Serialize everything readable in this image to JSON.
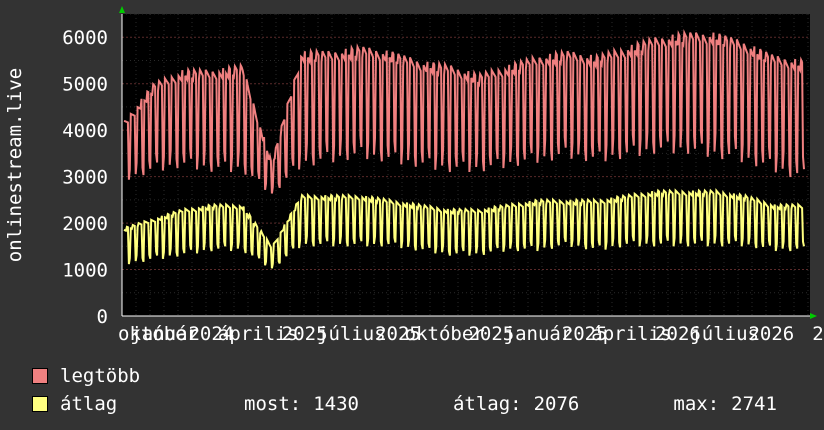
{
  "chart_data": {
    "type": "line",
    "ylabel": "onlinestream.live",
    "ylim": [
      0,
      6500
    ],
    "y_ticks": [
      "0",
      "1000",
      "2000",
      "3000",
      "4000",
      "5000",
      "6000"
    ],
    "x_tick_labels": [
      "október",
      "január",
      "2024",
      "április",
      "2025",
      "július",
      "2025",
      "október",
      "2025",
      "január",
      "2025",
      "április",
      "2026",
      "július",
      "2026",
      "2"
    ],
    "grid": true,
    "colors": {
      "background": "#000000",
      "grid_major": "#5a2a2a",
      "grid_minor": "#2a2a2a",
      "axis": "#ffffff",
      "arrow": "#00cc00"
    },
    "series": [
      {
        "name": "legtöbb",
        "color": "#f08080",
        "envelope_values": [
          4200,
          5000,
          5300,
          5300,
          5400,
          3300,
          5700,
          5700,
          5800,
          5700,
          5500,
          5400,
          5200,
          5400,
          5600,
          5700,
          5600,
          5800,
          6000,
          6100,
          6100,
          5900,
          5600,
          5500
        ],
        "dip_values": [
          2900,
          3100,
          3200,
          3100,
          3100,
          2600,
          3200,
          3300,
          3400,
          3300,
          3200,
          3100,
          3100,
          3200,
          3300,
          3400,
          3300,
          3400,
          3500,
          3500,
          3400,
          3300,
          3100,
          2900
        ]
      },
      {
        "name": "átlag",
        "color": "#ffff80",
        "envelope_values": [
          1900,
          2100,
          2300,
          2400,
          2400,
          1500,
          2600,
          2600,
          2600,
          2500,
          2400,
          2300,
          2300,
          2400,
          2500,
          2500,
          2500,
          2600,
          2700,
          2700,
          2700,
          2600,
          2400,
          2400
        ],
        "dip_values": [
          1100,
          1200,
          1300,
          1400,
          1400,
          1000,
          1500,
          1500,
          1500,
          1500,
          1400,
          1300,
          1300,
          1400,
          1400,
          1500,
          1400,
          1500,
          1500,
          1500,
          1500,
          1500,
          1400,
          1400
        ]
      }
    ]
  },
  "legend": {
    "items": [
      {
        "label": "legtöbb",
        "color": "#f08080"
      },
      {
        "label": "átlag",
        "color": "#ffff80"
      }
    ],
    "stats": [
      {
        "label": "most:",
        "value": "1430"
      },
      {
        "label": "átlag:",
        "value": "2076"
      },
      {
        "label": "max:",
        "value": "2741"
      }
    ]
  }
}
